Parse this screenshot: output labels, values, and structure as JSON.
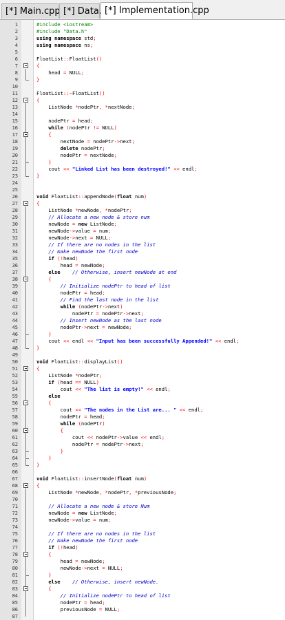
{
  "tabs": [
    {
      "label": "[*] Main.cpp",
      "active": false
    },
    {
      "label": "[*] Data.h",
      "active": false
    },
    {
      "label": "[*] Implementation.cpp",
      "active": true
    }
  ],
  "lines": [
    "#include <iostream>",
    "#include \"Data.h\"",
    "using namespace std;",
    "using namespace ns;",
    "",
    "FloatList::FloatList()",
    "{",
    "    head = NULL;",
    "}",
    "",
    "FloatList::~FloatList()",
    "{",
    "    ListNode *nodePtr, *nextNode;",
    "",
    "    nodePtr = head;",
    "    while (nodePtr != NULL)",
    "    {",
    "        nextNode = nodePtr->next;",
    "        delete nodePtr;",
    "        nodePtr = nextNode;",
    "    }",
    "    cout << \"Linked List has been destroyed!\" << endl;",
    "}",
    "",
    "",
    "void FloatList::appendNode(float num)",
    "{",
    "    ListNode *newNode, *nodePtr;",
    "    // Allocate a new node & store num",
    "    newNode = new ListNode;",
    "    newNode->value = num;",
    "    newNode->next = NULL;",
    "    // If there are no nodes in the list",
    "    // make newNode the first node",
    "    if (!head)",
    "        head = newNode;",
    "    else    // Otherwise, insert newNode at end",
    "    {",
    "        // Initialize nodePtr to head of list",
    "        nodePtr = head;",
    "        // Find the last node in the list",
    "        while (nodePtr->next)",
    "            nodePtr = nodePtr->next;",
    "        // Insert newNode as the last node",
    "        nodePtr->next = newNode;",
    "    }",
    "    cout << endl << \"Input has been successfully Appended!\" << endl;",
    "}",
    "",
    "void FloatList::displayList()",
    "{",
    "    ListNode *nodePtr;",
    "    if (head == NULL)",
    "        cout << \"The list is empty!\" << endl;",
    "    else",
    "    {",
    "        cout << \"The nodes in the List are... \" << endl;",
    "        nodePtr = head;",
    "        while (nodePtr)",
    "        {",
    "            cout << nodePtr->value << endl;",
    "            nodePtr = nodePtr->next;",
    "        }",
    "    }",
    "}",
    "",
    "void FloatList::insertNode(float num)",
    "{",
    "    ListNode *newNode, *nodePtr, *previousNode;",
    "",
    "    // Allocate a new node & store Num",
    "    newNode = new ListNode;",
    "    newNode->value = num;",
    "",
    "    // If there are no nodes in the list",
    "    // make newNode the first node",
    "    if (!head)",
    "    {",
    "        head = newNode;",
    "        newNode->next = NULL;",
    "    }",
    "    else    // Otherwise, insert newNode.",
    "    {",
    "        // Initialize nodePtr to head of list",
    "        nodePtr = head;",
    "        previousNode = NULL;",
    ""
  ],
  "colors": {
    "keyword": "#000000",
    "string": "#0000ff",
    "preprocessor": "#008000",
    "comment": "#0000c8",
    "symbol": "#ff0000",
    "type": "#000000"
  }
}
